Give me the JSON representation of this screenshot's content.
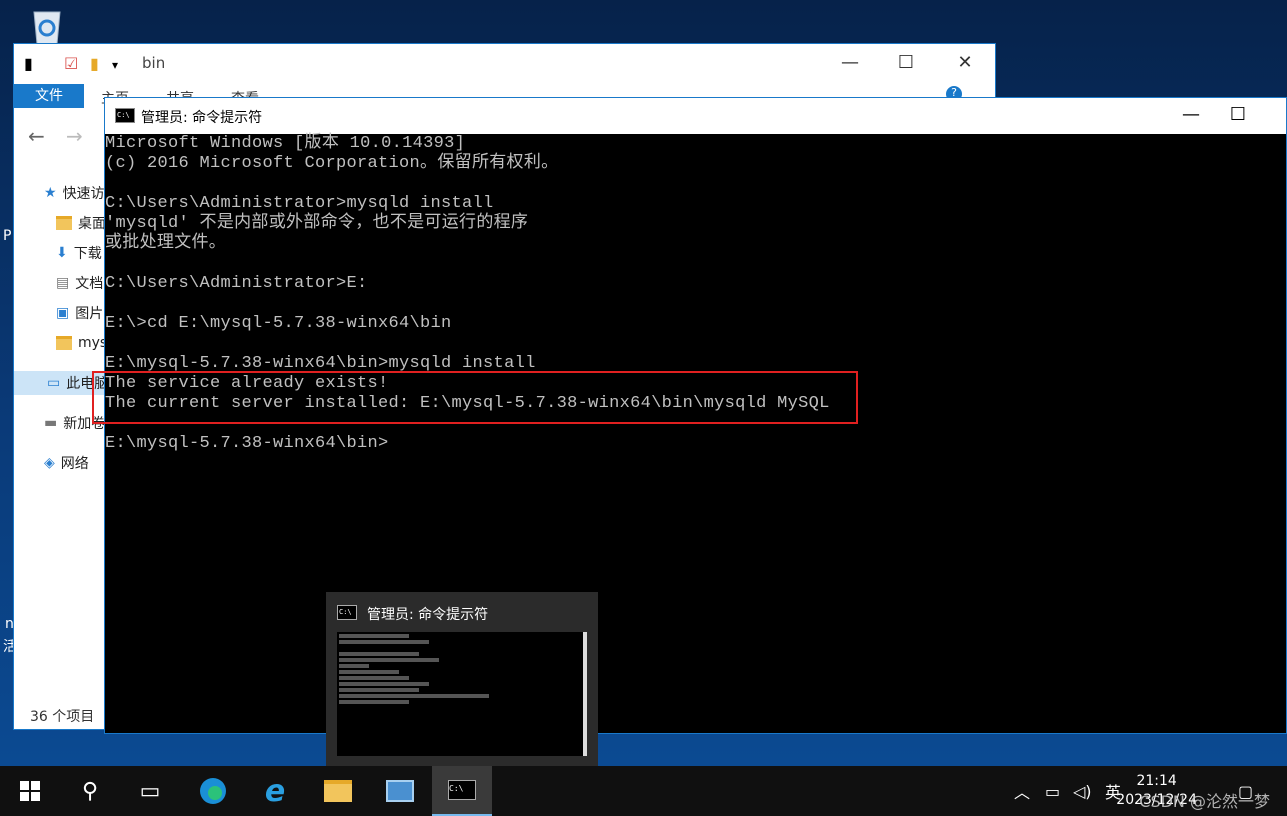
{
  "desktop": {
    "recycle_bin": "recycle-bin-icon",
    "edge_texts": [
      "P",
      "n",
      "活"
    ]
  },
  "explorer": {
    "title": "bin",
    "tab_file": "文件",
    "tabs": [
      "主页",
      "共享",
      "查看"
    ],
    "nav_tree": [
      {
        "label": "快速访问",
        "icon": "star-icon"
      },
      {
        "label": "桌面",
        "icon": "folder-icon"
      },
      {
        "label": "下载",
        "icon": "download-icon"
      },
      {
        "label": "文档",
        "icon": "document-icon"
      },
      {
        "label": "图片",
        "icon": "picture-icon"
      },
      {
        "label": "mysql",
        "icon": "folder-icon"
      },
      {
        "label": "此电脑",
        "icon": "computer-icon"
      },
      {
        "label": "新加卷",
        "icon": "drive-icon"
      },
      {
        "label": "网络",
        "icon": "network-icon"
      }
    ],
    "status": "36 个项目"
  },
  "cmd": {
    "title": "管理员: 命令提示符",
    "lines": [
      "Microsoft Windows [版本 10.0.14393]",
      "(c) 2016 Microsoft Corporation。保留所有权利。",
      "",
      "C:\\Users\\Administrator>mysqld install",
      "'mysqld' 不是内部或外部命令，也不是可运行的程序",
      "或批处理文件。",
      "",
      "C:\\Users\\Administrator>E:",
      "",
      "E:\\>cd E:\\mysql-5.7.38-winx64\\bin",
      "",
      "E:\\mysql-5.7.38-winx64\\bin>mysqld install",
      "The service already exists!",
      "The current server installed: E:\\mysql-5.7.38-winx64\\bin\\mysqld MySQL",
      "",
      "E:\\mysql-5.7.38-winx64\\bin>"
    ]
  },
  "thumbnail": {
    "title": "管理员: 命令提示符"
  },
  "taskbar": {
    "items": [
      "start-icon",
      "search-icon",
      "task-view-icon",
      "edge-icon",
      "ie-icon",
      "file-explorer-icon",
      "server-manager-icon",
      "cmd-icon"
    ],
    "ime": "英",
    "time": "21:14",
    "date": "2023/12/24",
    "watermark": "CSDN @沦然一梦"
  }
}
